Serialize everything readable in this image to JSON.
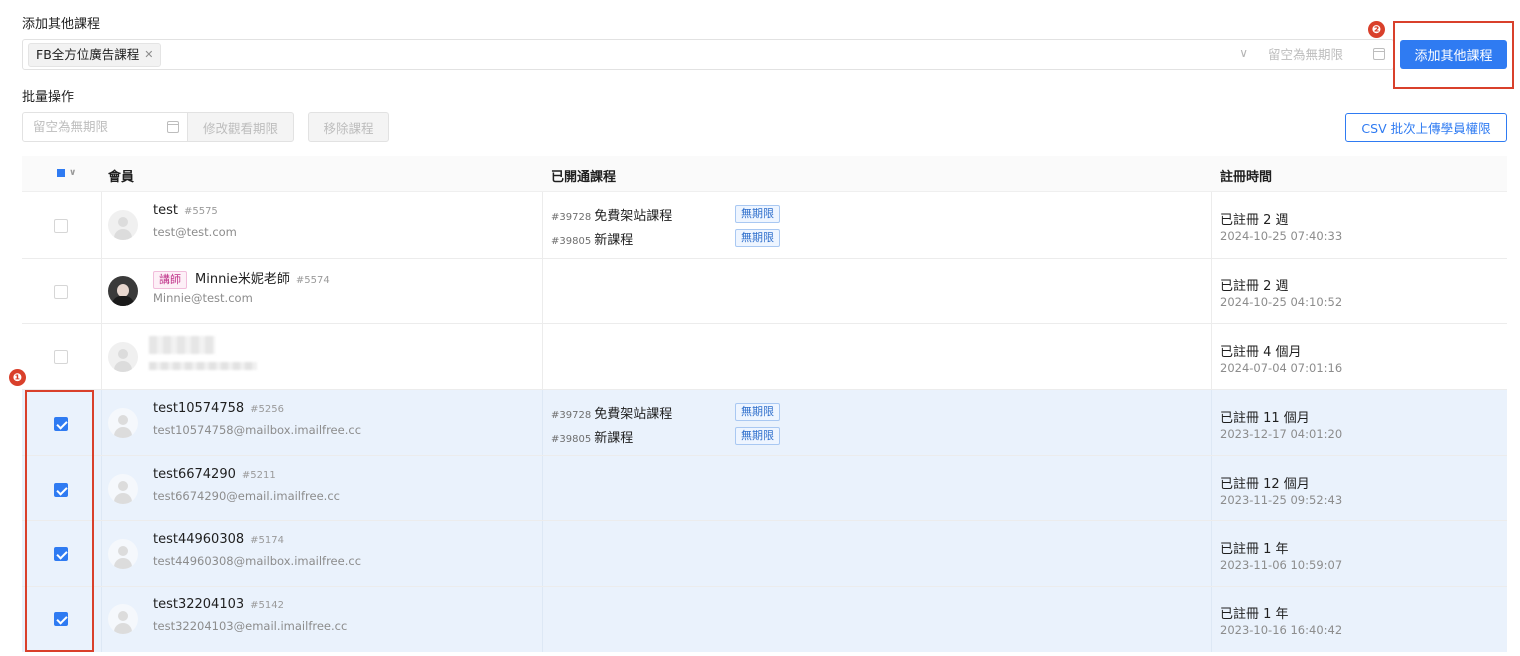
{
  "add_courses": {
    "label": "添加其他課程",
    "selected_tag": "FB全方位廣告課程",
    "date_placeholder": "留空為無期限",
    "add_button": "添加其他課程"
  },
  "batch": {
    "label": "批量操作",
    "date_placeholder": "留空為無期限",
    "modify_button": "修改觀看期限",
    "remove_button": "移除課程",
    "csv_button": "CSV 批次上傳學員權限"
  },
  "annotations": {
    "one": "❶",
    "two": "❷",
    "color": "#d9402b"
  },
  "table": {
    "headers": {
      "member": "會員",
      "courses": "已開通課程",
      "registered": "註冊時間"
    },
    "rows": [
      {
        "name": "test",
        "id": "#5575",
        "email": "test@test.com",
        "checked": false,
        "courses": [
          {
            "id": "#39728",
            "name": "免費架站課程",
            "tag": "無期限"
          },
          {
            "id": "#39805",
            "name": "新課程",
            "tag": "無期限"
          }
        ],
        "registered": "已註冊 2 週",
        "registered_at": "2024-10-25 07:40:33"
      },
      {
        "role": "講師",
        "name": "Minnie米妮老師",
        "id": "#5574",
        "email": "Minnie@test.com",
        "checked": false,
        "courses": [],
        "registered": "已註冊 2 週",
        "registered_at": "2024-10-25 04:10:52"
      },
      {
        "checked": false,
        "courses": [],
        "registered": "已註冊 4 個月",
        "registered_at": "2024-07-04 07:01:16"
      },
      {
        "name": "test10574758",
        "id": "#5256",
        "email": "test10574758@mailbox.imailfree.cc",
        "checked": true,
        "courses": [
          {
            "id": "#39728",
            "name": "免費架站課程",
            "tag": "無期限"
          },
          {
            "id": "#39805",
            "name": "新課程",
            "tag": "無期限"
          }
        ],
        "registered": "已註冊 11 個月",
        "registered_at": "2023-12-17 04:01:20"
      },
      {
        "name": "test6674290",
        "id": "#5211",
        "email": "test6674290@email.imailfree.cc",
        "checked": true,
        "courses": [],
        "registered": "已註冊 12 個月",
        "registered_at": "2023-11-25 09:52:43"
      },
      {
        "name": "test44960308",
        "id": "#5174",
        "email": "test44960308@mailbox.imailfree.cc",
        "checked": true,
        "courses": [],
        "registered": "已註冊 1 年",
        "registered_at": "2023-11-06 10:59:07"
      },
      {
        "name": "test32204103",
        "id": "#5142",
        "email": "test32204103@email.imailfree.cc",
        "checked": true,
        "courses": [],
        "registered": "已註冊 1 年",
        "registered_at": "2023-10-16 16:40:42"
      }
    ]
  },
  "colors": {
    "primary": "#2f7bf2",
    "selected_row": "#eaf2fc",
    "annotation": "#d9402b"
  }
}
